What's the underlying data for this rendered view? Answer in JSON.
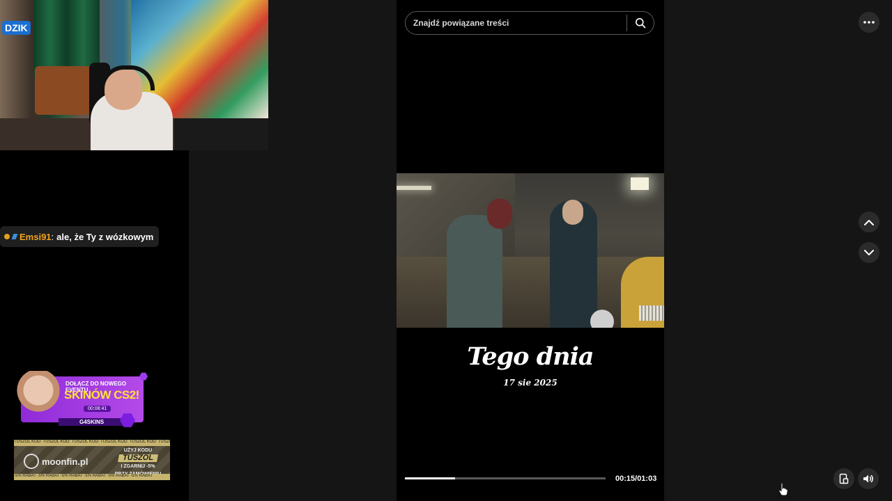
{
  "search": {
    "placeholder": "Znajdź powiązane treści"
  },
  "video": {
    "title": "Tego dnia",
    "date": "17 sie 2025",
    "elapsed": "00:15",
    "duration": "01:03",
    "time_display": "00:15/01:03",
    "progress_fraction": 0.25
  },
  "chat": {
    "username": "Emsi91",
    "separator": ":",
    "message": "ale, że Ty z wózkowym"
  },
  "overlay": {
    "webcam_logo": "DZIK",
    "promo": {
      "line1": "DOŁĄCZ DO NOWEGO EVENTU",
      "line2": "SKINÓW CS2!",
      "timer": "00:08:41",
      "brand": "G4SKINS"
    },
    "sponsor": {
      "brand": "moonfin.pl",
      "use_code": "UŻYJ KODU",
      "code": "TUSZOL",
      "discount": "I ZGARNIJ -5%",
      "at_order": "PRZY ZAMÓWIENIU",
      "ticker_top": "TUSZOL KOD: TUSZOL KOD: TUSZOL KOD: TUSZOL KOD: TUSZOL KOD: TUSZOL",
      "ticker_bottom": "-5% RABAT -5% RABAT -5% RABAT -5% RABAT -5% RABAT -5% RABAT"
    }
  },
  "icons": {
    "more": "more-icon",
    "up": "chevron-up-icon",
    "down": "chevron-down-icon",
    "pip": "picture-in-picture-icon",
    "volume": "volume-icon",
    "search": "search-icon"
  }
}
